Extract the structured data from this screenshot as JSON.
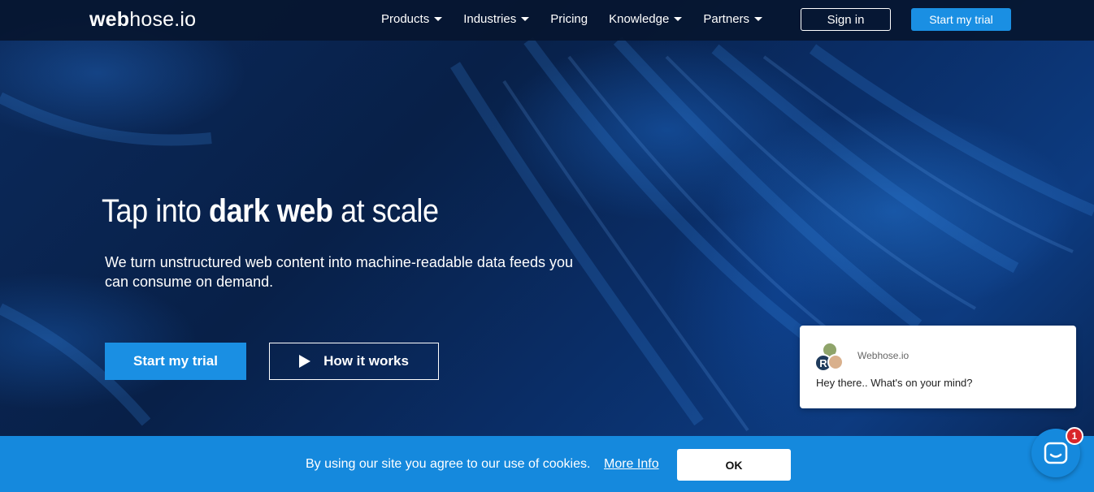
{
  "brand": {
    "logo_bold": "web",
    "logo_light": "hose.io"
  },
  "nav": {
    "items": [
      {
        "label": "Products",
        "has_dropdown": true
      },
      {
        "label": "Industries",
        "has_dropdown": true
      },
      {
        "label": "Pricing",
        "has_dropdown": false
      },
      {
        "label": "Knowledge",
        "has_dropdown": true
      },
      {
        "label": "Partners",
        "has_dropdown": true
      }
    ],
    "signin_label": "Sign in",
    "trial_label": "Start my trial"
  },
  "hero": {
    "headline_pre": "Tap into ",
    "headline_bold": "dark web",
    "headline_post": " at scale",
    "subtitle": "We turn unstructured web content into machine-readable data feeds you can consume on demand.",
    "cta_trial": "Start my trial",
    "cta_how": "How it works"
  },
  "chat": {
    "name": "Webhose.io",
    "message": "Hey there.. What's on your mind?",
    "avatar_initial": "R",
    "unread_count": "1"
  },
  "cookie": {
    "text": "By using our site you agree to our use of cookies.",
    "link": "More Info",
    "ok_label": "OK"
  },
  "colors": {
    "accent": "#1a8fe3",
    "cookie_bar": "#1589dd",
    "nav_bg": "#061630",
    "badge": "#d9262b"
  }
}
